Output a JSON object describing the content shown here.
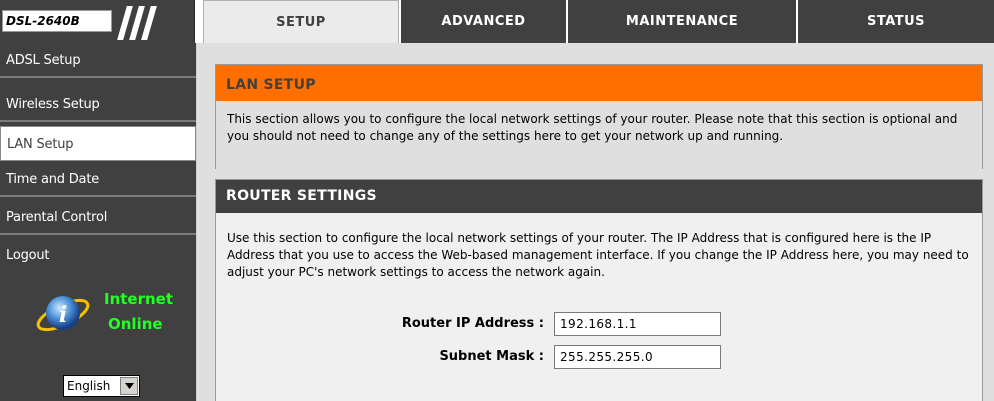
{
  "header": {
    "model": "DSL-2640B",
    "tabs": [
      {
        "label": "SETUP",
        "active": true
      },
      {
        "label": "ADVANCED",
        "active": false
      },
      {
        "label": "MAINTENANCE",
        "active": false
      },
      {
        "label": "STATUS",
        "active": false
      }
    ]
  },
  "sidebar": {
    "items": [
      {
        "label": "ADSL Setup",
        "active": false
      },
      {
        "label": "Wireless Setup",
        "active": false
      },
      {
        "label": "LAN Setup",
        "active": true
      },
      {
        "label": "Time and Date",
        "active": false
      },
      {
        "label": "Parental Control",
        "active": false
      },
      {
        "label": "Logout",
        "active": false
      }
    ],
    "status": {
      "line1": "Internet",
      "line2": "Online",
      "icon": "internet-globe-icon",
      "color": "#22ff22"
    },
    "language": {
      "selected": "English"
    }
  },
  "lan_setup": {
    "title": "LAN SETUP",
    "text": "This section allows you to configure the local network settings of your router. Please note that this section is optional and you should not need to change any of the settings here to get your network up and running."
  },
  "router_settings": {
    "title": "ROUTER SETTINGS",
    "text": "Use this section to configure the local network settings of your router. The IP Address that is configured here is the IP Address that you use to access the Web-based management interface. If you change the IP Address here, you may need to adjust your PC's network settings to access the network again.",
    "ip_label": "Router IP Address :",
    "ip_value": "192.168.1.1",
    "mask_label": "Subnet Mask :",
    "mask_value": "255.255.255.0"
  },
  "colors": {
    "accent": "#ff6f00",
    "dark": "#404040",
    "status_green": "#22ff22"
  }
}
